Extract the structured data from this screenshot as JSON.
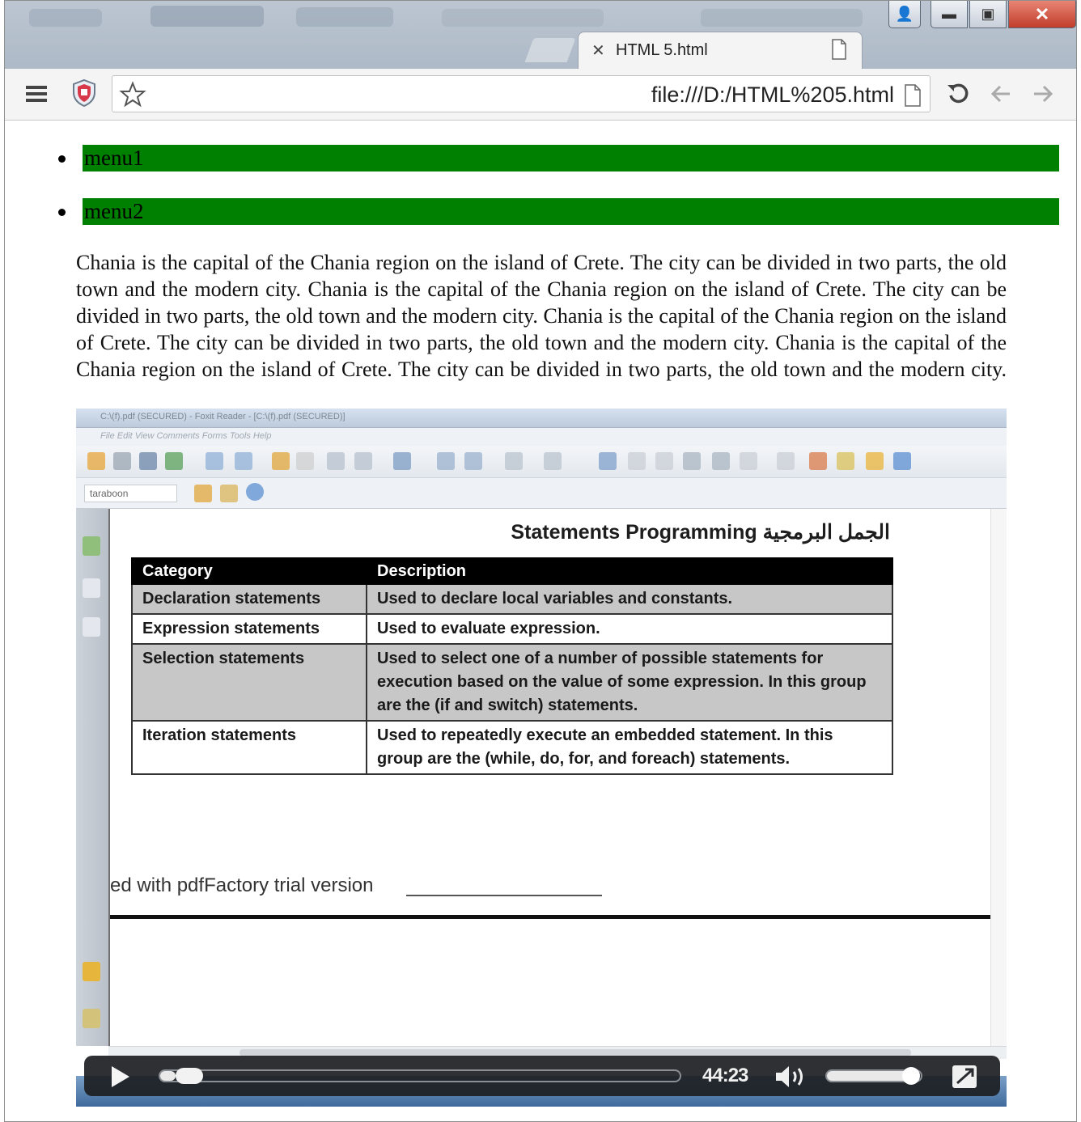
{
  "browser": {
    "tab": {
      "title": "HTML 5.html",
      "close_glyph": "✕"
    },
    "url": "file:///D:/HTML%205.html",
    "window_buttons": {
      "user": "👤",
      "minimize": "▬",
      "maximize": "▣",
      "close": "✕"
    }
  },
  "page": {
    "menu": [
      {
        "label": "menu1"
      },
      {
        "label": "menu2"
      }
    ],
    "menu_bg": "#008000",
    "paragraph": "Chania is the capital of the Chania region on the island of Crete. The city can be divided in two parts, the old town and the modern city. Chania is the capital of the Chania region on the island of Crete. The city can be divided in two parts, the old town and the modern city. Chania is the capital of the Chania region on the island of Crete. The city can be divided in two parts, the old town and the modern city. Chania is the capital of the Chania region on the island of Crete. The city can be divided in two parts, the old town and the modern city."
  },
  "video": {
    "app": {
      "title": "C:\\(f).pdf (SECURED) - Foxit Reader - [C:\\(f).pdf (SECURED)]",
      "menu": "File  Edit  View  Comments  Forms  Tools  Help",
      "zoom_field": "taraboon"
    },
    "document": {
      "heading": "Statements Programming  الجمل البرمجية",
      "table": {
        "headers": [
          "Category",
          "Description"
        ],
        "rows": [
          {
            "category": "Declaration statements",
            "description": "Used to declare local variables and constants."
          },
          {
            "category": "Expression statements",
            "description": "Used to evaluate expression."
          },
          {
            "category": "Selection statements",
            "description": "Used to select one of a number of possible statements for execution based on the value of some expression. In this group are the (if and switch) statements."
          },
          {
            "category": " Iteration statements",
            "description": "Used to repeatedly execute an embedded statement. In this group are the (while, do, for, and foreach) statements."
          }
        ]
      },
      "footer": "ed with pdfFactory trial version"
    },
    "player": {
      "time": "44:23",
      "progress": 0.03,
      "volume": 0.9
    }
  }
}
